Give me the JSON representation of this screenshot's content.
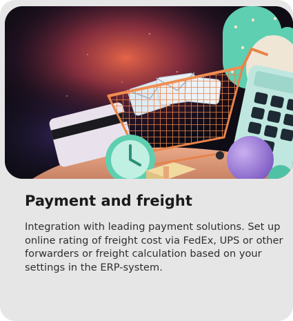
{
  "card": {
    "title": "Payment and freight",
    "description": "Integration with leading payment solutions. Set up online rating of freight cost via FedEx, UPS or other forwarders or freight calculation based on your settings in the ERP-system.",
    "illustration_icons": [
      "shopping-cart-icon",
      "credit-card-icon",
      "clock-icon",
      "calculator-icon",
      "package-icon",
      "cactus-icon",
      "envelope-icon"
    ]
  },
  "colors": {
    "card_background": "#e6e6e6",
    "hero_background": "#0e0c14",
    "cart": "#e07a3c",
    "mint": "#5ecfb0",
    "title": "#1a1a1a",
    "body_text": "#2e2e2e"
  }
}
